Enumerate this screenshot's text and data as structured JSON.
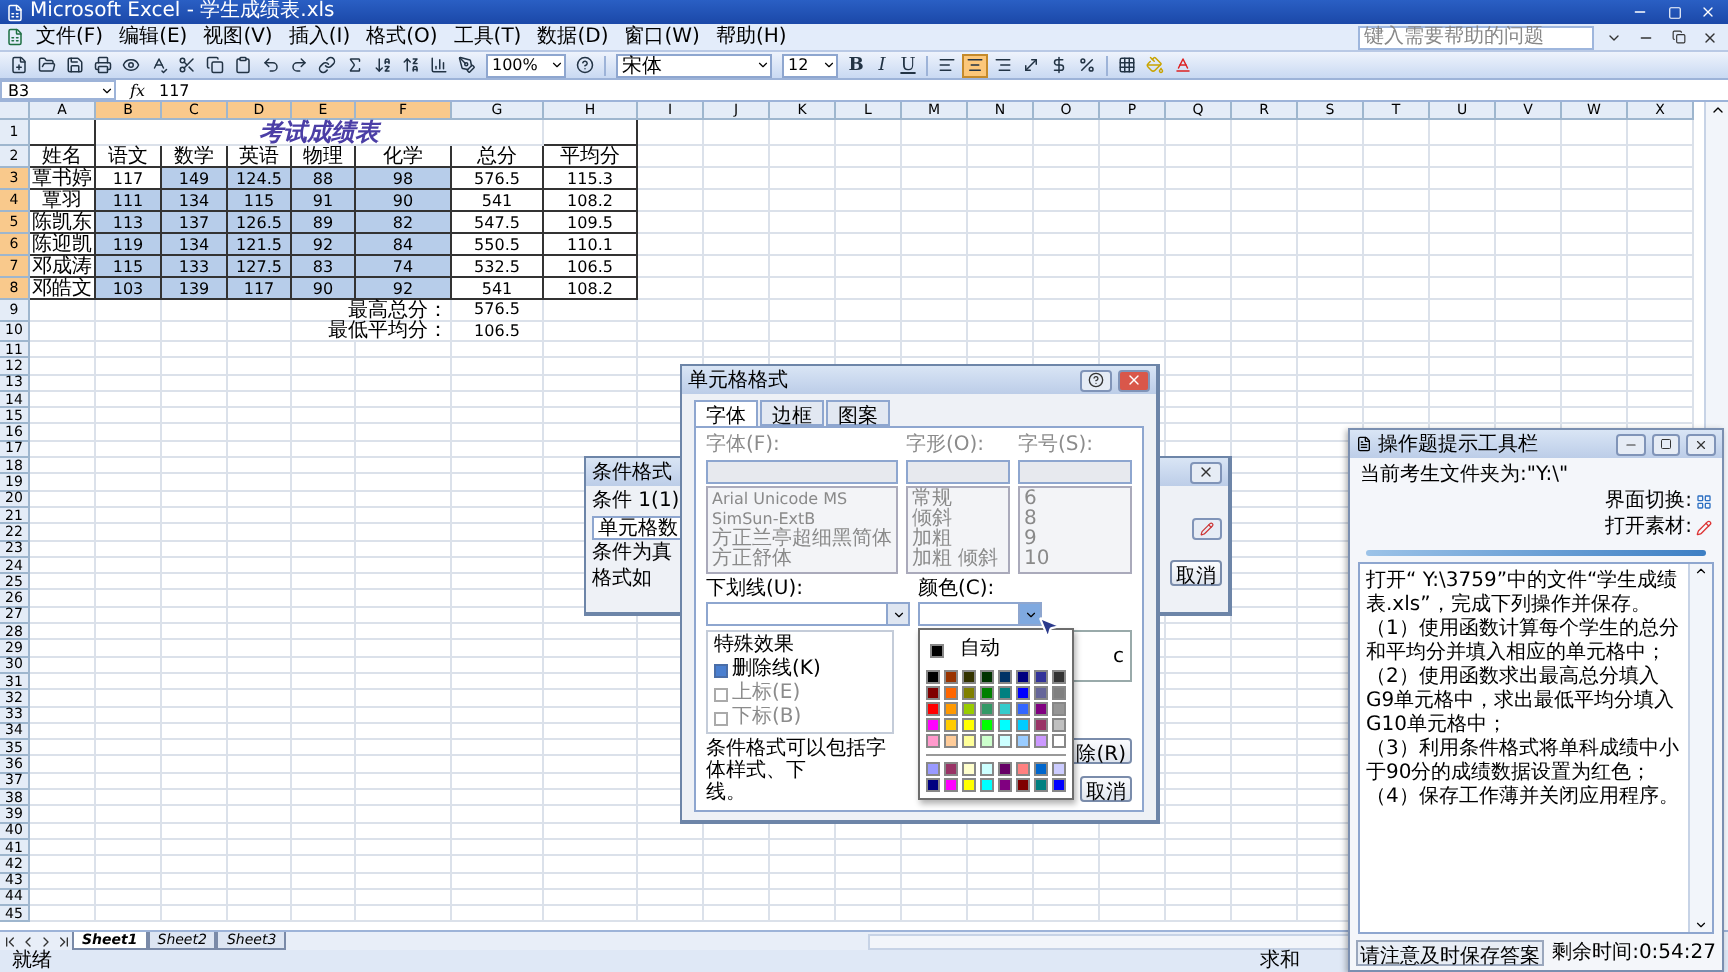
{
  "app": {
    "title": "Microsoft Excel - 学生成绩表.xls"
  },
  "menu": [
    "文件(F)",
    "编辑(E)",
    "视图(V)",
    "插入(I)",
    "格式(O)",
    "工具(T)",
    "数据(D)",
    "窗口(W)",
    "帮助(H)"
  ],
  "help_box": {
    "placeholder": "键入需要帮助的问题"
  },
  "toolbar": {
    "zoom": "100%",
    "font": "宋体",
    "size": "12",
    "style_buttons": [
      {
        "label": "B",
        "on": false
      },
      {
        "label": "I",
        "on": false
      },
      {
        "label": "U",
        "on": false
      }
    ],
    "align_buttons": [
      {
        "kind": "left",
        "selected": false
      },
      {
        "kind": "center",
        "selected": true
      },
      {
        "kind": "right",
        "selected": false
      }
    ]
  },
  "formula_bar": {
    "name_box": "B3",
    "function_label": "fx",
    "value": "117"
  },
  "sheet": {
    "columns": [
      "A",
      "B",
      "C",
      "D",
      "E",
      "F",
      "G",
      "H",
      "I",
      "J",
      "K",
      "L",
      "M",
      "N",
      "O",
      "P",
      "Q",
      "R",
      "S",
      "T",
      "U",
      "V",
      "W",
      "X"
    ],
    "rows": [
      {
        "n": "1",
        "kind": "title",
        "title": "考试成绩表"
      },
      {
        "n": "2",
        "kind": "header",
        "name": "姓名",
        "scores": [
          "语文",
          "数学",
          "英语",
          "物理",
          "化学"
        ],
        "total": "总分",
        "avg": "平均分"
      },
      {
        "n": "3",
        "kind": "student",
        "name": "覃书婷",
        "scores": [
          {
            "text": "117",
            "selected": false
          },
          {
            "text": "149",
            "selected": true
          },
          {
            "text": "124.5",
            "selected": true
          },
          {
            "text": "88",
            "selected": true
          },
          {
            "text": "98",
            "selected": true
          }
        ],
        "total": "576.5",
        "avg": "115.3"
      },
      {
        "n": "4",
        "kind": "student",
        "name": "覃羽",
        "scores": [
          {
            "text": "111",
            "selected": true
          },
          {
            "text": "134",
            "selected": true
          },
          {
            "text": "115",
            "selected": true
          },
          {
            "text": "91",
            "selected": true
          },
          {
            "text": "90",
            "selected": true
          }
        ],
        "total": "541",
        "avg": "108.2"
      },
      {
        "n": "5",
        "kind": "student",
        "name": "陈凯东",
        "scores": [
          {
            "text": "113",
            "selected": true
          },
          {
            "text": "137",
            "selected": true
          },
          {
            "text": "126.5",
            "selected": true
          },
          {
            "text": "89",
            "selected": true
          },
          {
            "text": "82",
            "selected": true
          }
        ],
        "total": "547.5",
        "avg": "109.5"
      },
      {
        "n": "6",
        "kind": "student",
        "name": "陈迎凯",
        "scores": [
          {
            "text": "119",
            "selected": true
          },
          {
            "text": "134",
            "selected": true
          },
          {
            "text": "121.5",
            "selected": true
          },
          {
            "text": "92",
            "selected": true
          },
          {
            "text": "84",
            "selected": true
          }
        ],
        "total": "550.5",
        "avg": "110.1"
      },
      {
        "n": "7",
        "kind": "student",
        "name": "邓成涛",
        "scores": [
          {
            "text": "115",
            "selected": true
          },
          {
            "text": "133",
            "selected": true
          },
          {
            "text": "127.5",
            "selected": true
          },
          {
            "text": "83",
            "selected": true
          },
          {
            "text": "74",
            "selected": true
          }
        ],
        "total": "532.5",
        "avg": "106.5"
      },
      {
        "n": "8",
        "kind": "student",
        "name": "邓皓文",
        "scores": [
          {
            "text": "103",
            "selected": true
          },
          {
            "text": "139",
            "selected": true
          },
          {
            "text": "117",
            "selected": true
          },
          {
            "text": "90",
            "selected": true
          },
          {
            "text": "92",
            "selected": true
          }
        ],
        "total": "541",
        "avg": "108.2"
      },
      {
        "n": "9",
        "kind": "summary",
        "label": "最高总分：",
        "value": "576.5"
      },
      {
        "n": "10",
        "kind": "summary",
        "label": "最低平均分：",
        "value": "106.5"
      },
      {
        "n": "11",
        "kind": "empty"
      },
      {
        "n": "12",
        "kind": "empty"
      },
      {
        "n": "13",
        "kind": "empty"
      },
      {
        "n": "14",
        "kind": "empty"
      },
      {
        "n": "15",
        "kind": "empty"
      },
      {
        "n": "16",
        "kind": "empty"
      },
      {
        "n": "17",
        "kind": "empty"
      },
      {
        "n": "18",
        "kind": "empty"
      },
      {
        "n": "19",
        "kind": "empty"
      },
      {
        "n": "20",
        "kind": "empty"
      },
      {
        "n": "21",
        "kind": "empty"
      },
      {
        "n": "22",
        "kind": "empty"
      },
      {
        "n": "23",
        "kind": "empty"
      },
      {
        "n": "24",
        "kind": "empty"
      },
      {
        "n": "25",
        "kind": "empty"
      },
      {
        "n": "26",
        "kind": "empty"
      },
      {
        "n": "27",
        "kind": "empty"
      },
      {
        "n": "28",
        "kind": "empty"
      },
      {
        "n": "29",
        "kind": "empty"
      },
      {
        "n": "30",
        "kind": "empty"
      },
      {
        "n": "31",
        "kind": "empty"
      },
      {
        "n": "32",
        "kind": "empty"
      },
      {
        "n": "33",
        "kind": "empty"
      },
      {
        "n": "34",
        "kind": "empty"
      },
      {
        "n": "35",
        "kind": "empty"
      },
      {
        "n": "36",
        "kind": "empty"
      },
      {
        "n": "37",
        "kind": "empty"
      },
      {
        "n": "38",
        "kind": "empty"
      },
      {
        "n": "39",
        "kind": "empty"
      },
      {
        "n": "40",
        "kind": "empty"
      },
      {
        "n": "41",
        "kind": "empty"
      },
      {
        "n": "42",
        "kind": "empty"
      },
      {
        "n": "43",
        "kind": "empty"
      },
      {
        "n": "44",
        "kind": "empty"
      },
      {
        "n": "45",
        "kind": "empty"
      }
    ]
  },
  "sheet_tabs": [
    {
      "label": "Sheet1",
      "selected": true
    },
    {
      "label": "Sheet2",
      "selected": false
    },
    {
      "label": "Sheet3",
      "selected": false
    }
  ],
  "status_bar": {
    "left": "就绪",
    "right": "求和"
  },
  "conditional_dialog": {
    "title": "条件格式",
    "condition_label": "条件 1(1)",
    "condition_value": "单元格数",
    "text_lines": [
      "条件为真",
      "格式如"
    ],
    "cancel": "取消"
  },
  "format_dialog": {
    "title": "单元格格式",
    "tabs": [
      {
        "label": "字体",
        "selected": true
      },
      {
        "label": "边框",
        "selected": false
      },
      {
        "label": "图案",
        "selected": false
      }
    ],
    "lists": [
      {
        "label": "字体(F):",
        "disabled": true,
        "items": [
          "Arial Unicode MS",
          "SimSun-ExtB",
          "方正兰亭超细黑简体",
          "方正舒体"
        ]
      },
      {
        "label": "字形(O):",
        "disabled": true,
        "items": [
          "常规",
          "倾斜",
          "加粗",
          "加粗 倾斜"
        ]
      },
      {
        "label": "字号(S):",
        "disabled": true,
        "items": [
          "6",
          "8",
          "9",
          "10"
        ]
      }
    ],
    "underline_label": "下划线(U):",
    "color_label": "颜色(C):",
    "effects_label": "特殊效果",
    "effects": [
      {
        "label": "删除线(K)",
        "checked": true,
        "disabled": false
      },
      {
        "label": "上标(E)",
        "checked": false,
        "disabled": true
      },
      {
        "label": "下标(B)",
        "checked": false,
        "disabled": true
      }
    ],
    "preview_text": "c",
    "footnote_lines": [
      "条件格式可以包括字体样式、下",
      "线。"
    ],
    "buttons": [
      "除(R)",
      "取消"
    ]
  },
  "palette": {
    "auto_label": "自动",
    "auto": {
      "color": "#000000"
    },
    "standard": [
      [
        {
          "color": "#000000"
        },
        {
          "color": "#993300"
        },
        {
          "color": "#333300"
        },
        {
          "color": "#003300"
        },
        {
          "color": "#003366"
        },
        {
          "color": "#000080"
        },
        {
          "color": "#333399"
        },
        {
          "color": "#333333"
        }
      ],
      [
        {
          "color": "#800000"
        },
        {
          "color": "#ff6600"
        },
        {
          "color": "#808000"
        },
        {
          "color": "#008000"
        },
        {
          "color": "#008080"
        },
        {
          "color": "#0000ff"
        },
        {
          "color": "#666699"
        },
        {
          "color": "#808080"
        }
      ],
      [
        {
          "color": "#ff0000"
        },
        {
          "color": "#ff9900"
        },
        {
          "color": "#99cc00"
        },
        {
          "color": "#339966"
        },
        {
          "color": "#33cccc"
        },
        {
          "color": "#3366ff"
        },
        {
          "color": "#800080"
        },
        {
          "color": "#969696"
        }
      ],
      [
        {
          "color": "#ff00ff"
        },
        {
          "color": "#ffcc00"
        },
        {
          "color": "#ffff00"
        },
        {
          "color": "#00ff00"
        },
        {
          "color": "#00ffff"
        },
        {
          "color": "#00ccff"
        },
        {
          "color": "#993366"
        },
        {
          "color": "#c0c0c0"
        }
      ],
      [
        {
          "color": "#ff99cc"
        },
        {
          "color": "#ffcc99"
        },
        {
          "color": "#ffff99"
        },
        {
          "color": "#ccffcc"
        },
        {
          "color": "#ccffff"
        },
        {
          "color": "#99ccff"
        },
        {
          "color": "#cc99ff"
        },
        {
          "color": "#ffffff"
        }
      ]
    ],
    "extra": [
      [
        {
          "color": "#9999ff"
        },
        {
          "color": "#993366"
        },
        {
          "color": "#ffffcc"
        },
        {
          "color": "#ccffff"
        },
        {
          "color": "#660066"
        },
        {
          "color": "#ff8080"
        },
        {
          "color": "#0066cc"
        },
        {
          "color": "#ccccff"
        }
      ],
      [
        {
          "color": "#000080"
        },
        {
          "color": "#ff00ff"
        },
        {
          "color": "#ffff00"
        },
        {
          "color": "#00ffff"
        },
        {
          "color": "#800080"
        },
        {
          "color": "#800000"
        },
        {
          "color": "#008080"
        },
        {
          "color": "#0000ff"
        }
      ]
    ]
  },
  "panel": {
    "title": "操作题提示工具栏",
    "folder_label": "当前考生文件夹为:\"Y:\\\"",
    "switch_label": "界面切换:",
    "open_label": "打开素材:",
    "instructions": [
      "打开“ Y:\\3759”中的文件“学生成绩表.xls”，完成下列操作并保存。",
      "（1）使用函数计算每个学生的总分和平均分并填入相应的单元格中；",
      "（2）使用函数求出最高总分填入G9单元格中，求出最低平均分填入G10单元格中；",
      "（3）利用条件格式将单科成绩中小于90分的成绩数据设置为红色；",
      "（4）保存工作薄并关闭应用程序。"
    ],
    "save_button": "请注意及时保存答案",
    "timer": "剩余时间:0:54:27"
  }
}
